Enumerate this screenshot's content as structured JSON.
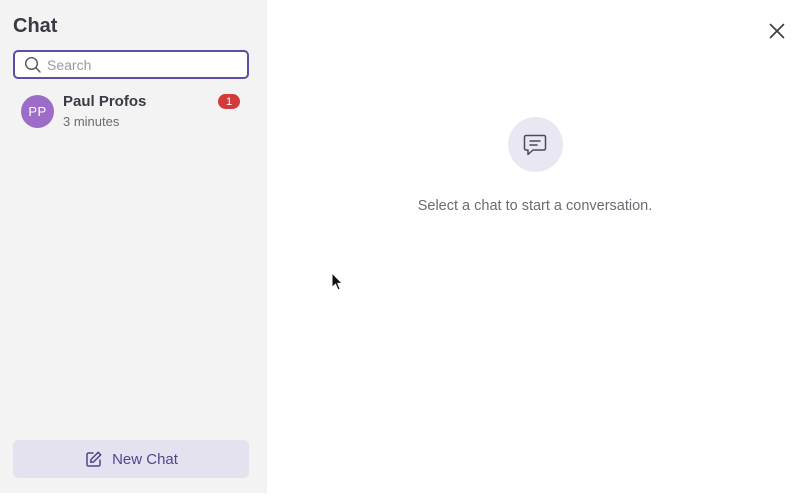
{
  "sidebar": {
    "title": "Chat",
    "search": {
      "placeholder": "Search",
      "value": "",
      "icon": "search-icon"
    },
    "conversations": [
      {
        "initials": "PP",
        "name": "Paul Profos",
        "time": "3 minutes",
        "unread": "1",
        "avatar_color": "#9b6dc6"
      }
    ],
    "new_chat_label": "New Chat",
    "new_chat_icon": "edit-icon"
  },
  "main": {
    "empty_state_text": "Select a chat to start a conversation.",
    "empty_state_icon": "chat-bubble-icon",
    "close_icon": "close-icon"
  },
  "colors": {
    "accent": "#5a4fa6",
    "badge": "#d33a3a",
    "sidebar_bg": "#f3f3f4"
  }
}
